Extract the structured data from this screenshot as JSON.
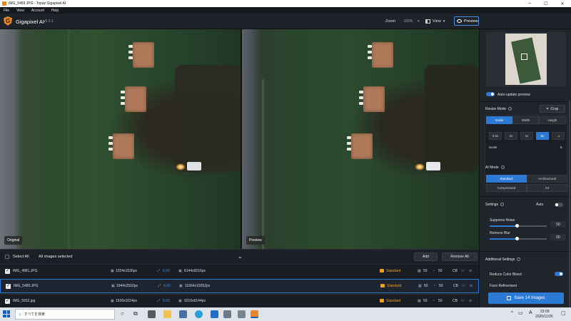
{
  "window": {
    "title": "IMG_5489.JPG - Topaz Gigapixel AI",
    "minimize": "─",
    "maximize": "☐",
    "close": "✕"
  },
  "menu": [
    "File",
    "View",
    "Account",
    "Help"
  ],
  "header": {
    "app_name": "Gigapixel AI",
    "version": "v5.3.1",
    "zoom_label": "Zoom",
    "zoom_value": "100%",
    "view_label": "View",
    "preview_label": "Preview"
  },
  "panes": {
    "left_label": "Original",
    "right_label": "Preview"
  },
  "list_bar": {
    "select_all": "Select All",
    "all_selected": "All images selected",
    "add": "Add",
    "remove_all": "Remove All"
  },
  "files": [
    {
      "name": "IMG_4881.JPG",
      "input_size": "1024x1536px",
      "scale": "6.00",
      "output_size": "6144x9216px",
      "model": "Standard",
      "noise": "50",
      "blur": "50",
      "color_bleed": "CB",
      "selected": false
    },
    {
      "name": "IMG_5489.JPG",
      "input_size": "1944x2592px",
      "scale": "6.00",
      "output_size": "11664x15552px",
      "model": "Standard",
      "noise": "50",
      "blur": "50",
      "color_bleed": "CB",
      "selected": true
    },
    {
      "name": "IMG_5932.jpg",
      "input_size": "1536x1024px",
      "scale": "6.00",
      "output_size": "9216x6144px",
      "model": "Standard",
      "noise": "50",
      "blur": "50",
      "color_bleed": "CB",
      "selected": false
    }
  ],
  "right_panel": {
    "auto_update": "Auto-update preview",
    "resize_mode": {
      "title": "Resize Mode",
      "crop": "Crop",
      "tabs": [
        "Scale",
        "Width",
        "Height"
      ],
      "active_tab": "Scale",
      "scales": [
        "0.5x",
        "2x",
        "4x",
        "6x",
        "..x"
      ],
      "active_scale": "6x",
      "scale_label": "Scale",
      "scale_value": "6"
    },
    "ai_mode": {
      "title": "AI Mode",
      "options": [
        "Standard",
        "Architectural",
        "Compressed",
        "Art"
      ],
      "active": "Standard"
    },
    "settings": {
      "title": "Settings",
      "auto": "Auto",
      "suppress_noise": {
        "label": "Suppress Noise",
        "value": "50"
      },
      "remove_blur": {
        "label": "Remove Blur",
        "value": "50"
      }
    },
    "additional": {
      "title": "Additional Settings",
      "reduce_color_bleed": "Reduce Color Bleed",
      "face_refinement": "Face Refinement"
    },
    "save_button": "Save 14 Images"
  },
  "taskbar": {
    "search_placeholder": "すべてを検索",
    "time": "23:09",
    "date": "2020/11/26",
    "ime": "A"
  },
  "colors": {
    "accent": "#2d7ad6",
    "brand": "#e8872a",
    "tag": "#f0a020"
  }
}
